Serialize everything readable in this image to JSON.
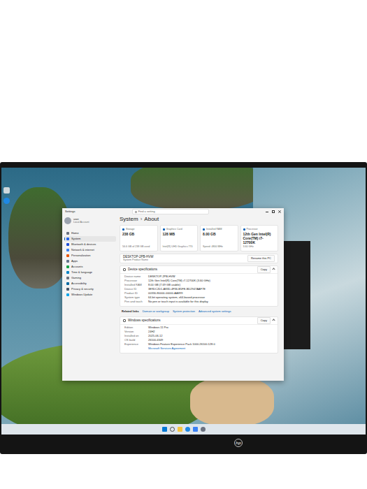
{
  "window": {
    "title": "Settings"
  },
  "search": {
    "placeholder": "Find a setting"
  },
  "account": {
    "name": "user",
    "type": "Local Account"
  },
  "sidebar": {
    "items": [
      {
        "label": "Home",
        "selected": false,
        "color": "#6b7280"
      },
      {
        "label": "System",
        "selected": true,
        "color": "#2563eb"
      },
      {
        "label": "Bluetooth & devices",
        "selected": false,
        "color": "#1d4ed8"
      },
      {
        "label": "Network & internet",
        "selected": false,
        "color": "#3b82f6"
      },
      {
        "label": "Personalization",
        "selected": false,
        "color": "#ea580c"
      },
      {
        "label": "Apps",
        "selected": false,
        "color": "#64748b"
      },
      {
        "label": "Accounts",
        "selected": false,
        "color": "#16a34a"
      },
      {
        "label": "Time & language",
        "selected": false,
        "color": "#0284c7"
      },
      {
        "label": "Gaming",
        "selected": false,
        "color": "#6b7280"
      },
      {
        "label": "Accessibility",
        "selected": false,
        "color": "#0369a1"
      },
      {
        "label": "Privacy & security",
        "selected": false,
        "color": "#475569"
      },
      {
        "label": "Windows Update",
        "selected": false,
        "color": "#0ea5e9"
      }
    ]
  },
  "breadcrumb": {
    "parent": "System",
    "separator": "›",
    "current": "About"
  },
  "cards": [
    {
      "label": "Storage",
      "value": "238 GB",
      "detail": "56.6 GB of 238 GB used"
    },
    {
      "label": "Graphics Card",
      "value": "128 MB",
      "detail": "Intel(R) UHD Graphics 770"
    },
    {
      "label": "Installed RAM",
      "value": "8.00 GB",
      "detail": "Speed: 4800 MHz"
    },
    {
      "label": "Processor",
      "value": "12th Gen Intel(R) Core(TM) i7-12700K",
      "detail": "3.60 GHz"
    }
  ],
  "pc": {
    "name": "DESKTOP-2PB-HVW",
    "model": "System Product Name",
    "button": "Rename this PC"
  },
  "device_specs": {
    "title": "Device specifications",
    "button": "Copy",
    "expanded": true,
    "rows": [
      {
        "label": "Device name",
        "value": "DESKTOP-2PB-HVW"
      },
      {
        "label": "Processor",
        "value": "12th Gen Intel(R) Core(TM) i7-12700K (3.60 GHz)"
      },
      {
        "label": "Installed RAM",
        "value": "8.00 GB (7.69 GB usable)"
      },
      {
        "label": "Device ID",
        "value": "3E9DC2D1-A83D-4F36-B5FE-BD2947AAF7E"
      },
      {
        "label": "Product ID",
        "value": "00330-80000-00000-AA899"
      },
      {
        "label": "System type",
        "value": "64-bit operating system, x64-based processor"
      },
      {
        "label": "Pen and touch",
        "value": "No pen or touch input is available for this display"
      }
    ]
  },
  "related_links": {
    "label": "Related links",
    "links": [
      "Domain or workgroup",
      "System protection",
      "Advanced system settings"
    ]
  },
  "windows_specs": {
    "title": "Windows specifications",
    "button": "Copy",
    "expanded": true,
    "rows": [
      {
        "label": "Edition",
        "value": "Windows 11 Pro"
      },
      {
        "label": "Version",
        "value": "24H2"
      },
      {
        "label": "Installed on",
        "value": "2025-06-12"
      },
      {
        "label": "OS build",
        "value": "26100.4349"
      },
      {
        "label": "Experience",
        "value": "Windows Feature Experience Pack 1000.26100.128.0"
      },
      {
        "label": "",
        "value": "Microsoft Services Agreement"
      }
    ]
  },
  "monitor": {
    "brand": "hp"
  }
}
